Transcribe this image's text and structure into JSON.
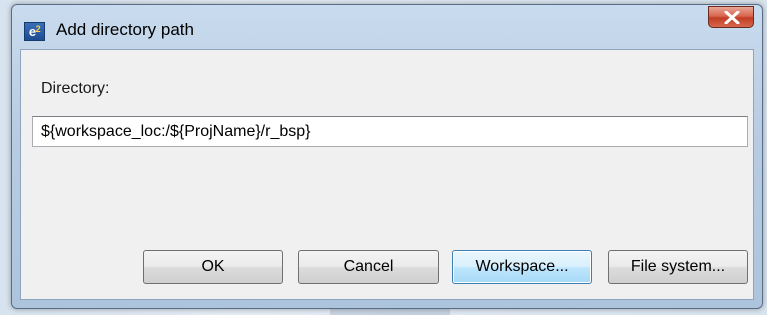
{
  "window": {
    "title": "Add directory path",
    "icon_label": "e",
    "icon_superscript": "2"
  },
  "form": {
    "directory_label": "Directory:",
    "directory_value": "${workspace_loc:/${ProjName}/r_bsp}"
  },
  "buttons": {
    "ok": "OK",
    "cancel": "Cancel",
    "workspace": "Workspace...",
    "file_system": "File system..."
  },
  "colors": {
    "titlebar": "#b8cde3",
    "close_button": "#c94b34",
    "content_background": "#f0f0f0",
    "focused_button_border": "#3c7fb1"
  },
  "icons": {
    "app": "e2-app-icon",
    "close": "close-icon"
  }
}
